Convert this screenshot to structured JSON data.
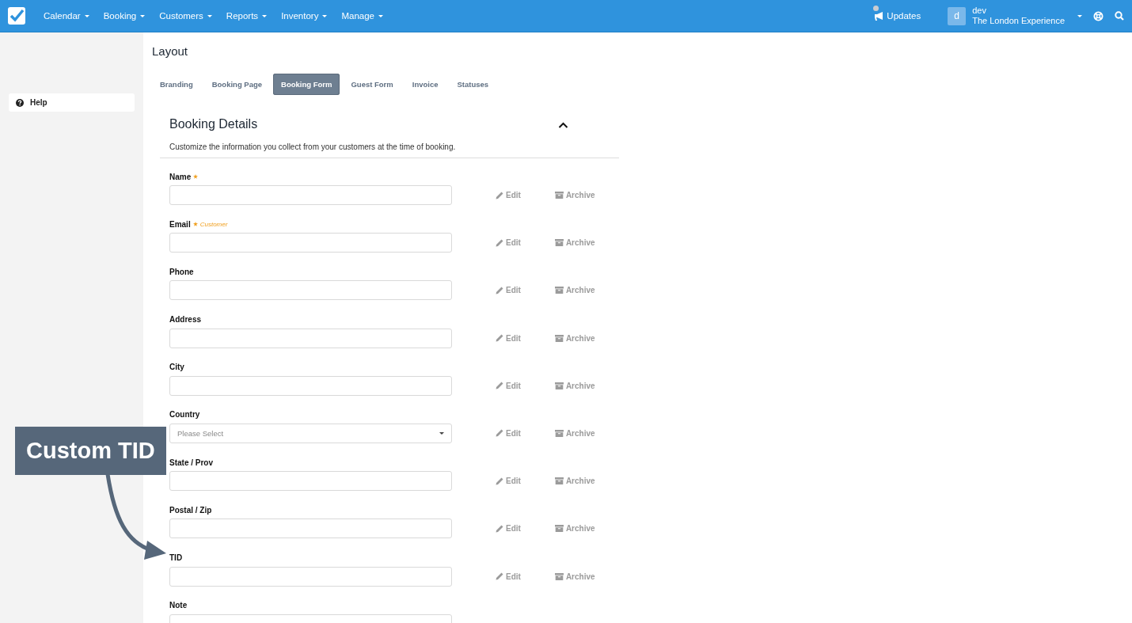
{
  "topbar": {
    "menu": [
      {
        "label": "Calendar"
      },
      {
        "label": "Booking"
      },
      {
        "label": "Customers"
      },
      {
        "label": "Reports"
      },
      {
        "label": "Inventory"
      },
      {
        "label": "Manage"
      }
    ],
    "updates": "Updates",
    "user": {
      "avatar": "d",
      "name": "dev",
      "company": "The London Experience"
    }
  },
  "sidebar": {
    "items": [
      {
        "label": "Help"
      }
    ]
  },
  "page": {
    "title": "Layout"
  },
  "tabs": [
    {
      "label": "Branding",
      "selected": false
    },
    {
      "label": "Booking Page",
      "selected": false
    },
    {
      "label": "Booking Form",
      "selected": true
    },
    {
      "label": "Guest Form",
      "selected": false
    },
    {
      "label": "Invoice",
      "selected": false
    },
    {
      "label": "Statuses",
      "selected": false
    }
  ],
  "section": {
    "title": "Booking Details",
    "expanded": true,
    "description": "Customize the information you collect from your customers at the time of booking."
  },
  "fields": [
    {
      "label": "Name",
      "required": true,
      "kind": "text",
      "edit": "Edit",
      "archive": "Archive"
    },
    {
      "label": "Email",
      "required": true,
      "note": "Customer",
      "kind": "text",
      "edit": "Edit",
      "archive": "Archive"
    },
    {
      "label": "Phone",
      "required": false,
      "kind": "text",
      "edit": "Edit",
      "archive": "Archive"
    },
    {
      "label": "Address",
      "required": false,
      "kind": "text",
      "edit": "Edit",
      "archive": "Archive"
    },
    {
      "label": "City",
      "required": false,
      "kind": "text",
      "edit": "Edit",
      "archive": "Archive"
    },
    {
      "label": "Country",
      "required": false,
      "kind": "select",
      "placeholder": "Please Select",
      "edit": "Edit",
      "archive": "Archive"
    },
    {
      "label": "State / Prov",
      "required": false,
      "kind": "text",
      "edit": "Edit",
      "archive": "Archive"
    },
    {
      "label": "Postal / Zip",
      "required": false,
      "kind": "text",
      "edit": "Edit",
      "archive": "Archive"
    },
    {
      "label": "TID",
      "required": false,
      "kind": "text",
      "edit": "Edit",
      "archive": "Archive"
    },
    {
      "label": "Note",
      "required": false,
      "kind": "text"
    }
  ],
  "callout": {
    "text": "Custom TID"
  }
}
